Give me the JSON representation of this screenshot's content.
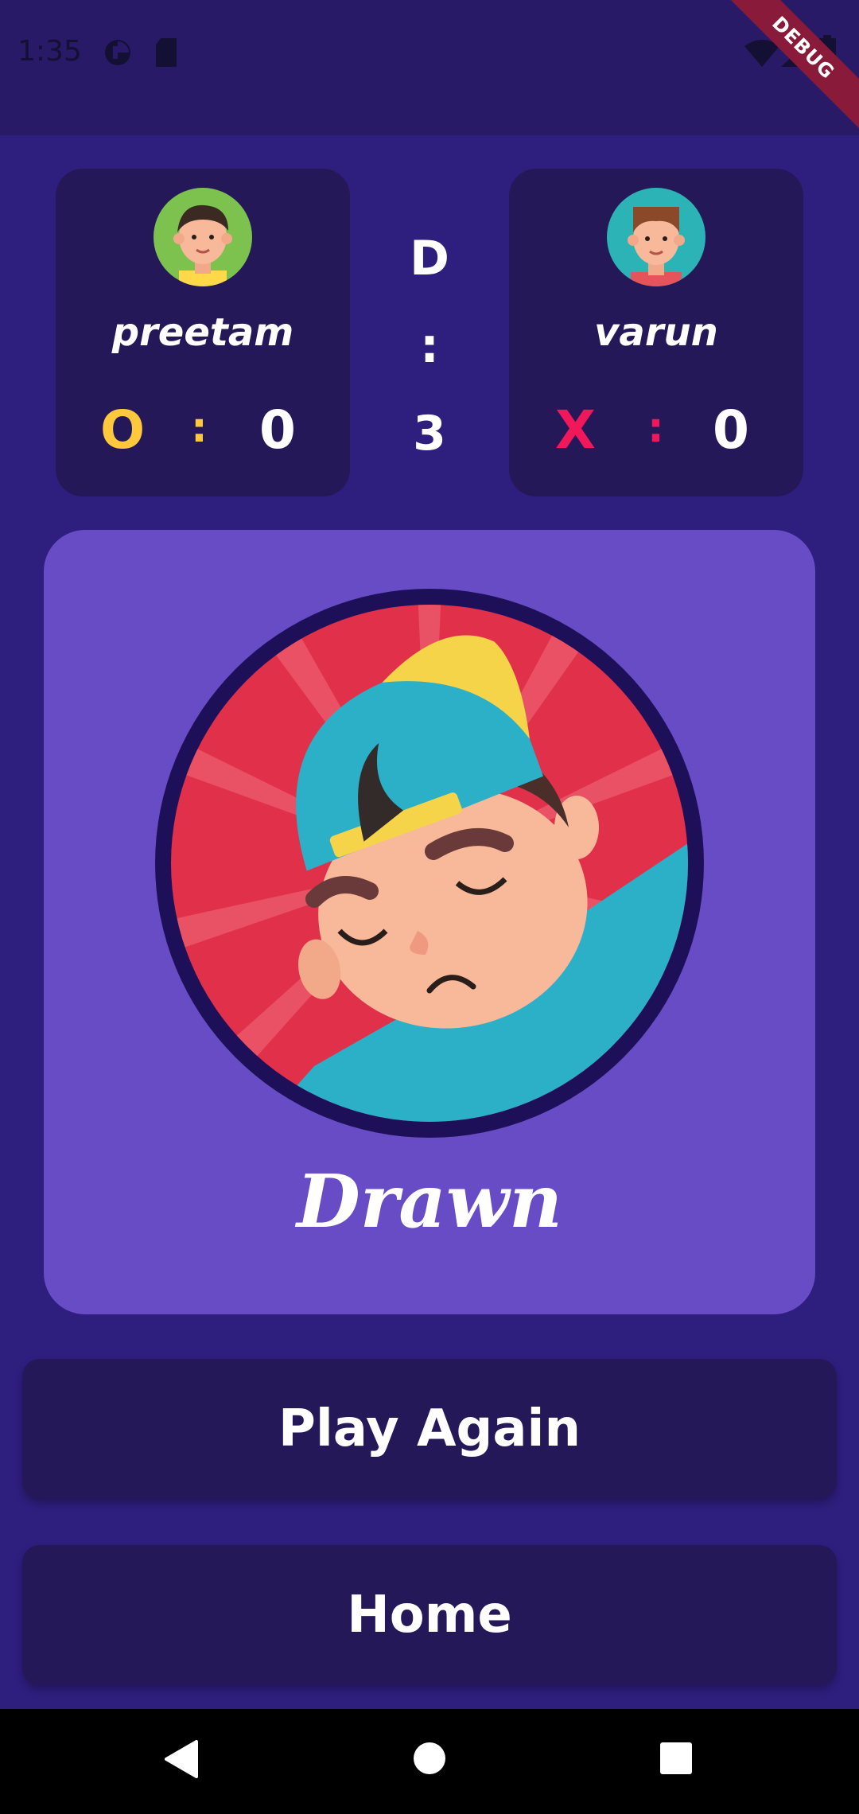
{
  "status_bar": {
    "time": "1:35",
    "debug_label": "DEBUG",
    "icons": [
      "data-saver-icon",
      "sd-card-icon",
      "wifi-icon",
      "signal-icon",
      "battery-icon"
    ]
  },
  "players": [
    {
      "name": "preetam",
      "mark": "O",
      "separator": ":",
      "score": "0",
      "mark_color": "#ffc83d",
      "avatar": "boy-avatar-green-icon"
    },
    {
      "name": "varun",
      "mark": "X",
      "separator": ":",
      "score": "0",
      "mark_color": "#f0185a",
      "avatar": "boy-avatar-teal-icon"
    }
  ],
  "draws": {
    "label": "D",
    "separator": ":",
    "count": "3"
  },
  "result": {
    "text": "Drawn",
    "image": "sad-boy-icon"
  },
  "buttons": {
    "play_again": "Play Again",
    "home": "Home"
  },
  "nav": [
    "back-icon",
    "home-icon",
    "recents-icon"
  ],
  "colors": {
    "background": "#2e1e7e",
    "card": "#251858",
    "result_card": "#684cc5",
    "o_mark": "#ffc83d",
    "x_mark": "#f0185a"
  }
}
